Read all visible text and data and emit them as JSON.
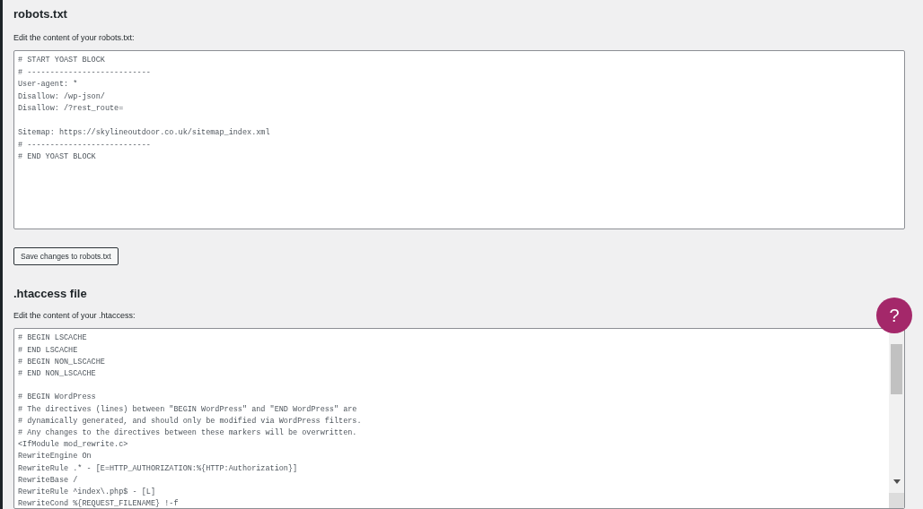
{
  "robots": {
    "title": "robots.txt",
    "label": "Edit the content of your robots.txt:",
    "content": "# START YOAST BLOCK\n# ---------------------------\nUser-agent: *\nDisallow: /wp-json/\nDisallow: /?rest_route=\n\nSitemap: https://skylineoutdoor.co.uk/sitemap_index.xml\n# ---------------------------\n# END YOAST BLOCK",
    "button": "Save changes to robots.txt"
  },
  "htaccess": {
    "title": ".htaccess file",
    "label": "Edit the content of your .htaccess:",
    "content": "# BEGIN LSCACHE\n# END LSCACHE\n# BEGIN NON_LSCACHE\n# END NON_LSCACHE\n\n# BEGIN WordPress\n# The directives (lines) between \"BEGIN WordPress\" and \"END WordPress\" are\n# dynamically generated, and should only be modified via WordPress filters.\n# Any changes to the directives between these markers will be overwritten.\n<IfModule mod_rewrite.c>\nRewriteEngine On\nRewriteRule .* - [E=HTTP_AUTHORIZATION:%{HTTP:Authorization}]\nRewriteBase /\nRewriteRule ^index\\.php$ - [L]\nRewriteCond %{REQUEST_FILENAME} !-f"
  },
  "help_button": "?"
}
